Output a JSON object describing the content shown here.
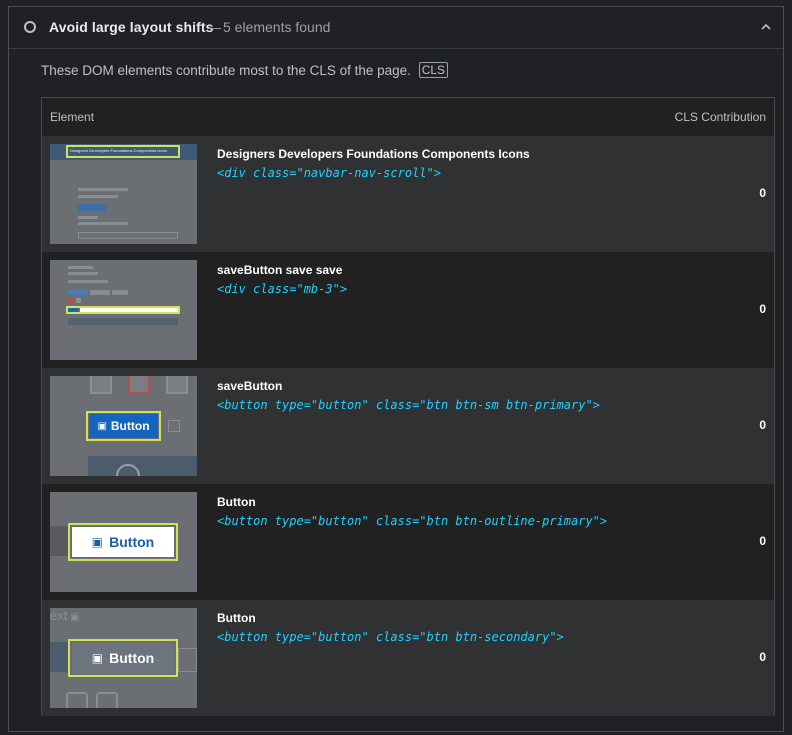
{
  "audit": {
    "title": "Avoid large layout shifts",
    "separator": "—",
    "count_text": "5 elements found",
    "description": "These DOM elements contribute most to the CLS of the page.",
    "tag": "CLS"
  },
  "table": {
    "col_element": "Element",
    "col_cls": "CLS Contribution",
    "rows": [
      {
        "label": "Designers Developers Foundations Components Icons",
        "code": "<div class=\"navbar-nav-scroll\">",
        "value": "0"
      },
      {
        "label": "saveButton save save",
        "code": "<div class=\"mb-3\">",
        "value": "0"
      },
      {
        "label": "saveButton",
        "code": "<button type=\"button\" class=\"btn btn-sm btn-primary\">",
        "value": "0"
      },
      {
        "label": "Button",
        "code": "<button type=\"button\" class=\"btn btn-outline-primary\">",
        "value": "0"
      },
      {
        "label": "Button",
        "code": "<button type=\"button\" class=\"btn btn-secondary\">",
        "value": "0"
      }
    ]
  },
  "thumbs": {
    "nav_items": "Designers  Developers  Foundations  Components  Icons",
    "btn_text": "Button",
    "partial_text": "ext"
  },
  "icons": {
    "status": "circle-outline-icon",
    "collapse": "chevron-up-icon",
    "save": "floppy-disk-icon"
  },
  "colors": {
    "accent_code": "#21d0ff",
    "highlight": "#d4e157",
    "primary_button": "#1565c0"
  }
}
